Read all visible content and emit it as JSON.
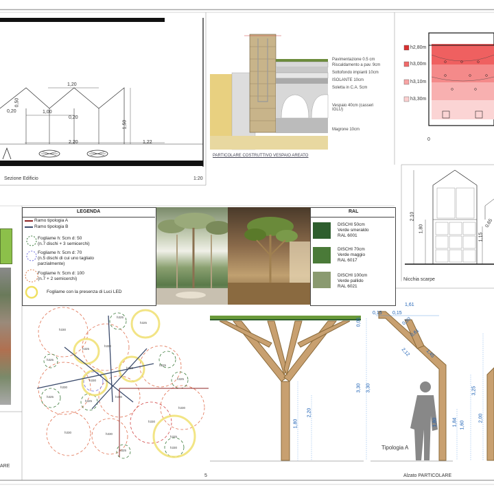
{
  "section": {
    "caption": "Sezione Edificio",
    "scale": "1:20",
    "dims": {
      "d120": "1,20",
      "d100": "1,00",
      "d020a": "0,20",
      "d050": "0,50",
      "d020b": "0,20",
      "d220": "2,20",
      "d150": "1,50",
      "d122": "1,22"
    }
  },
  "vespaio": {
    "caption": "PARTICOLARE COSTRUTTIVO VESPAIO AREATO",
    "layers": [
      "Pavimentazione 0.5 cm",
      "Riscaldamento a pav. 9cm",
      "Sottofondo impianti 10cm",
      "ISOLANTE 10cm",
      "Soletta in C.A. 5cm",
      "Vespaio 40cm (casseri IGLU)",
      "Magrone 10cm"
    ]
  },
  "heights": {
    "h1": "h2,80m",
    "h2": "h3,00m",
    "h3": "h3,10m",
    "h4": "h3,30m",
    "zero": "0"
  },
  "nicchia": {
    "caption": "Nicchia scarpe",
    "dims": {
      "d210": "2,10",
      "d180": "1,80",
      "d115": "1,15",
      "d065": "0,65"
    }
  },
  "legend": {
    "title": "LEGENDA",
    "items": [
      "Ramo tipologia A",
      "Ramo tipologia B",
      "Fogliame h: 5cm d: 50\n(n.7 dischi + 3 semicerchi)",
      "Fogliame h: 5cm d: 70\n(n.5 dischi di cui uno tagliato\nparzialmente)",
      "Fogliame h: 5cm d: 100\n(n.7 + 2 semicerchi)",
      "Fogliame con la presenza di Luci LED"
    ],
    "colors": [
      "#8b2020",
      "#3a4a6b",
      "#3a7a3a",
      "#7070e0",
      "#e08050",
      "#f0e060"
    ]
  },
  "ral": {
    "title": "RAL",
    "items": [
      {
        "label": "DISCHI 50cm\nVerde smeraldo\nRAL 6001",
        "color": "#2e5e2e"
      },
      {
        "label": "DISCHI 70cm\nVerde maggio\nRAL 6017",
        "color": "#4a7a38"
      },
      {
        "label": "DISCHI 100cm\nVerde pallido\nRAL 6021",
        "color": "#8a9a70"
      }
    ]
  },
  "plan_labels": [
    "h330",
    "h325",
    "h330",
    "h325",
    "h330",
    "h330",
    "h325",
    "h330",
    "h330",
    "h325",
    "h330",
    "h330",
    "h325",
    "h330",
    "h330",
    "h330",
    "h325",
    "h330",
    "h325",
    "h330",
    "h330",
    "h325",
    "h330",
    "h330",
    "h325",
    "h330",
    "h330"
  ],
  "elevation": {
    "caption": "Alzato PARTICOLARE",
    "tipologia": "Tipologia A",
    "page_num": "5",
    "dims": {
      "d161": "1,61",
      "d015a": "0,15",
      "d015b": "0,15",
      "d050": "0,50",
      "d061": "0,61",
      "d145": "1,45",
      "d212": "2,12",
      "d005": "0,05",
      "d330a": "3,30",
      "d330b": "3,30",
      "d180a": "1,80",
      "d220": "2,20",
      "d180b": "1,80",
      "d184": "1,84",
      "d160": "1,60",
      "d325": "3,25",
      "d200": "2,00"
    }
  },
  "left_fragment": "ARE"
}
